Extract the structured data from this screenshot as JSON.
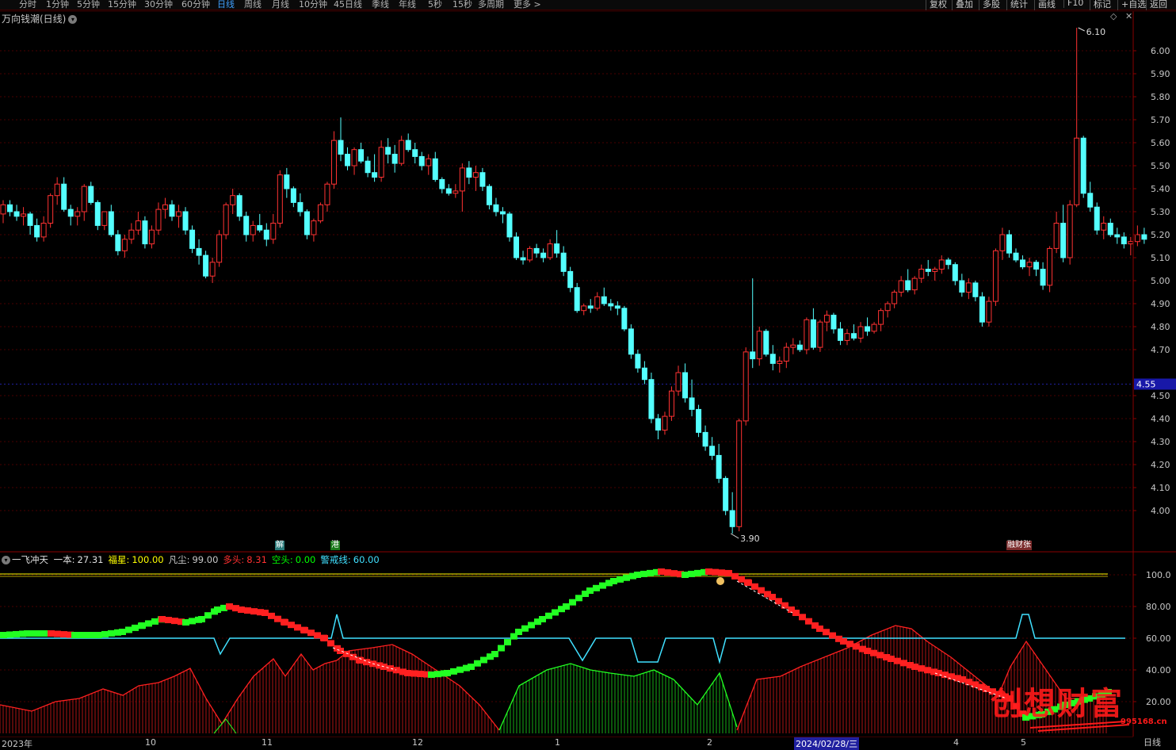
{
  "toolbar": {
    "periods": [
      "分时",
      "1分钟",
      "5分钟",
      "15分钟",
      "30分钟",
      "60分钟",
      "日线",
      "周线",
      "月线",
      "10分钟",
      "45日线",
      "季线",
      "年线",
      "5秒",
      "15秒",
      "多周期",
      "更多 >"
    ],
    "active_period": "日线",
    "tools": [
      "复权",
      "叠加",
      "多股",
      "统计",
      "画线",
      "F10",
      "标记",
      "+自选",
      "返回"
    ]
  },
  "main_chart": {
    "title": "万向钱潮(日线)",
    "price_axis": [
      "6.00",
      "5.90",
      "5.80",
      "5.70",
      "5.60",
      "5.50",
      "5.40",
      "5.30",
      "5.20",
      "5.10",
      "5.00",
      "4.90",
      "4.80",
      "4.70",
      "4.55",
      "4.50",
      "4.40",
      "4.30",
      "4.20",
      "4.10",
      "4.00"
    ],
    "current_price": "4.55",
    "high_label": "6.10",
    "low_label": "3.90",
    "flags": [
      "解",
      "港",
      "融财张"
    ]
  },
  "indicator": {
    "name": "一飞冲天",
    "items": [
      {
        "label": "一本:",
        "value": "27.31",
        "color": "#e0e0e0"
      },
      {
        "label": "福星:",
        "value": "100.00",
        "color": "#ffff00"
      },
      {
        "label": "凡尘:",
        "value": "99.00",
        "color": "#c8c8c8"
      },
      {
        "label": "多头:",
        "value": "8.31",
        "color": "#ff3030"
      },
      {
        "label": "空头:",
        "value": "0.00",
        "color": "#00ff00"
      },
      {
        "label": "警戒线:",
        "value": "60.00",
        "color": "#40e0ff"
      }
    ],
    "axis": [
      "100.0",
      "80.00",
      "60.00",
      "40.00",
      "20.00"
    ]
  },
  "date_axis": {
    "labels": [
      "2023年",
      "10",
      "11",
      "12",
      "1",
      "2",
      "4",
      "5"
    ],
    "current": "2024/02/28/三",
    "period_label": "日线"
  },
  "watermark": {
    "text": "创想财富",
    "sub": "995168.cn"
  },
  "colors": {
    "up": "#ff3232",
    "down": "#54ffff",
    "bull": "#ff2020",
    "bear": "#22ff22",
    "warn": "#40e0ff",
    "level": "#ffff00"
  },
  "chart_data": {
    "type": "candlestick",
    "ohlc": [
      [
        5.29,
        5.35,
        5.25,
        5.33
      ],
      [
        5.33,
        5.35,
        5.28,
        5.3
      ],
      [
        5.3,
        5.33,
        5.26,
        5.28
      ],
      [
        5.28,
        5.32,
        5.24,
        5.29
      ],
      [
        5.29,
        5.3,
        5.2,
        5.24
      ],
      [
        5.24,
        5.27,
        5.17,
        5.19
      ],
      [
        5.19,
        5.28,
        5.17,
        5.25
      ],
      [
        5.25,
        5.38,
        5.23,
        5.37
      ],
      [
        5.37,
        5.45,
        5.33,
        5.42
      ],
      [
        5.42,
        5.45,
        5.3,
        5.31
      ],
      [
        5.31,
        5.33,
        5.24,
        5.28
      ],
      [
        5.28,
        5.32,
        5.24,
        5.3
      ],
      [
        5.3,
        5.42,
        5.26,
        5.41
      ],
      [
        5.41,
        5.43,
        5.33,
        5.34
      ],
      [
        5.34,
        5.35,
        5.22,
        5.24
      ],
      [
        5.24,
        5.3,
        5.22,
        5.3
      ],
      [
        5.3,
        5.33,
        5.19,
        5.2
      ],
      [
        5.2,
        5.22,
        5.11,
        5.13
      ],
      [
        5.13,
        5.2,
        5.1,
        5.18
      ],
      [
        5.18,
        5.25,
        5.16,
        5.22
      ],
      [
        5.22,
        5.3,
        5.2,
        5.26
      ],
      [
        5.26,
        5.28,
        5.14,
        5.16
      ],
      [
        5.16,
        5.24,
        5.14,
        5.22
      ],
      [
        5.22,
        5.34,
        5.2,
        5.31
      ],
      [
        5.31,
        5.36,
        5.27,
        5.33
      ],
      [
        5.33,
        5.35,
        5.26,
        5.28
      ],
      [
        5.28,
        5.33,
        5.23,
        5.3
      ],
      [
        5.3,
        5.32,
        5.2,
        5.22
      ],
      [
        5.22,
        5.24,
        5.12,
        5.14
      ],
      [
        5.14,
        5.18,
        5.07,
        5.11
      ],
      [
        5.11,
        5.13,
        5.01,
        5.02
      ],
      [
        5.02,
        5.1,
        4.99,
        5.08
      ],
      [
        5.08,
        5.22,
        5.06,
        5.2
      ],
      [
        5.2,
        5.34,
        5.18,
        5.33
      ],
      [
        5.33,
        5.4,
        5.29,
        5.37
      ],
      [
        5.37,
        5.38,
        5.26,
        5.28
      ],
      [
        5.28,
        5.3,
        5.17,
        5.2
      ],
      [
        5.2,
        5.26,
        5.17,
        5.24
      ],
      [
        5.24,
        5.29,
        5.21,
        5.22
      ],
      [
        5.22,
        5.25,
        5.15,
        5.18
      ],
      [
        5.18,
        5.29,
        5.16,
        5.25
      ],
      [
        5.25,
        5.48,
        5.23,
        5.46
      ],
      [
        5.46,
        5.49,
        5.36,
        5.4
      ],
      [
        5.4,
        5.41,
        5.32,
        5.34
      ],
      [
        5.34,
        5.38,
        5.28,
        5.3
      ],
      [
        5.3,
        5.31,
        5.18,
        5.2
      ],
      [
        5.2,
        5.27,
        5.17,
        5.26
      ],
      [
        5.26,
        5.34,
        5.25,
        5.33
      ],
      [
        5.33,
        5.43,
        5.3,
        5.42
      ],
      [
        5.42,
        5.65,
        5.4,
        5.61
      ],
      [
        5.61,
        5.71,
        5.52,
        5.55
      ],
      [
        5.55,
        5.58,
        5.48,
        5.5
      ],
      [
        5.5,
        5.58,
        5.46,
        5.57
      ],
      [
        5.57,
        5.6,
        5.51,
        5.52
      ],
      [
        5.52,
        5.54,
        5.45,
        5.47
      ],
      [
        5.47,
        5.55,
        5.43,
        5.45
      ],
      [
        5.45,
        5.61,
        5.43,
        5.58
      ],
      [
        5.58,
        5.62,
        5.51,
        5.55
      ],
      [
        5.55,
        5.59,
        5.47,
        5.51
      ],
      [
        5.51,
        5.63,
        5.5,
        5.61
      ],
      [
        5.61,
        5.64,
        5.56,
        5.57
      ],
      [
        5.57,
        5.6,
        5.51,
        5.54
      ],
      [
        5.54,
        5.56,
        5.48,
        5.5
      ],
      [
        5.5,
        5.55,
        5.46,
        5.53
      ],
      [
        5.53,
        5.56,
        5.43,
        5.44
      ],
      [
        5.44,
        5.45,
        5.38,
        5.4
      ],
      [
        5.4,
        5.42,
        5.37,
        5.38
      ],
      [
        5.38,
        5.42,
        5.36,
        5.39
      ],
      [
        5.39,
        5.51,
        5.3,
        5.49
      ],
      [
        5.49,
        5.52,
        5.42,
        5.45
      ],
      [
        5.45,
        5.5,
        5.39,
        5.47
      ],
      [
        5.47,
        5.49,
        5.39,
        5.41
      ],
      [
        5.41,
        5.42,
        5.31,
        5.33
      ],
      [
        5.33,
        5.36,
        5.28,
        5.3
      ],
      [
        5.3,
        5.32,
        5.25,
        5.29
      ],
      [
        5.29,
        5.3,
        5.17,
        5.19
      ],
      [
        5.19,
        5.21,
        5.09,
        5.1
      ],
      [
        5.1,
        5.13,
        5.07,
        5.09
      ],
      [
        5.09,
        5.15,
        5.08,
        5.14
      ],
      [
        5.14,
        5.16,
        5.1,
        5.12
      ],
      [
        5.12,
        5.14,
        5.08,
        5.1
      ],
      [
        5.1,
        5.18,
        5.09,
        5.16
      ],
      [
        5.16,
        5.22,
        5.1,
        5.12
      ],
      [
        5.12,
        5.15,
        5.02,
        5.04
      ],
      [
        5.04,
        5.06,
        4.95,
        4.97
      ],
      [
        4.97,
        4.99,
        4.86,
        4.87
      ],
      [
        4.87,
        4.9,
        4.85,
        4.89
      ],
      [
        4.89,
        4.92,
        4.86,
        4.88
      ],
      [
        4.88,
        4.95,
        4.87,
        4.93
      ],
      [
        4.93,
        4.97,
        4.89,
        4.9
      ],
      [
        4.9,
        4.92,
        4.87,
        4.89
      ],
      [
        4.89,
        4.91,
        4.85,
        4.88
      ],
      [
        4.88,
        4.89,
        4.78,
        4.79
      ],
      [
        4.79,
        4.81,
        4.66,
        4.68
      ],
      [
        4.68,
        4.7,
        4.6,
        4.62
      ],
      [
        4.62,
        4.65,
        4.55,
        4.57
      ],
      [
        4.57,
        4.6,
        4.38,
        4.4
      ],
      [
        4.4,
        4.42,
        4.31,
        4.35
      ],
      [
        4.35,
        4.43,
        4.33,
        4.41
      ],
      [
        4.41,
        4.54,
        4.39,
        4.52
      ],
      [
        4.52,
        4.63,
        4.5,
        4.6
      ],
      [
        4.6,
        4.64,
        4.47,
        4.49
      ],
      [
        4.49,
        4.57,
        4.41,
        4.44
      ],
      [
        4.44,
        4.46,
        4.32,
        4.34
      ],
      [
        4.34,
        4.37,
        4.26,
        4.28
      ],
      [
        4.28,
        4.32,
        4.22,
        4.24
      ],
      [
        4.24,
        4.29,
        4.12,
        4.14
      ],
      [
        4.14,
        4.15,
        3.98,
        4.0
      ],
      [
        4.0,
        4.08,
        3.9,
        3.93
      ],
      [
        3.93,
        4.4,
        3.91,
        4.39
      ],
      [
        4.39,
        4.71,
        4.37,
        4.69
      ],
      [
        4.69,
        5.01,
        4.62,
        4.66
      ],
      [
        4.66,
        4.8,
        4.63,
        4.78
      ],
      [
        4.78,
        4.79,
        4.67,
        4.68
      ],
      [
        4.68,
        4.72,
        4.61,
        4.64
      ],
      [
        4.64,
        4.67,
        4.6,
        4.65
      ],
      [
        4.65,
        4.73,
        4.62,
        4.71
      ],
      [
        4.71,
        4.75,
        4.68,
        4.72
      ],
      [
        4.72,
        4.74,
        4.69,
        4.7
      ],
      [
        4.7,
        4.84,
        4.68,
        4.83
      ],
      [
        4.83,
        4.88,
        4.7,
        4.71
      ],
      [
        4.71,
        4.83,
        4.69,
        4.82
      ],
      [
        4.82,
        4.87,
        4.78,
        4.85
      ],
      [
        4.85,
        4.86,
        4.77,
        4.79
      ],
      [
        4.79,
        4.82,
        4.72,
        4.74
      ],
      [
        4.74,
        4.79,
        4.72,
        4.77
      ],
      [
        4.77,
        4.81,
        4.74,
        4.75
      ],
      [
        4.75,
        4.82,
        4.73,
        4.8
      ],
      [
        4.8,
        4.84,
        4.76,
        4.78
      ],
      [
        4.78,
        4.82,
        4.77,
        4.81
      ],
      [
        4.81,
        4.88,
        4.78,
        4.87
      ],
      [
        4.87,
        4.91,
        4.84,
        4.9
      ],
      [
        4.9,
        4.96,
        4.88,
        4.95
      ],
      [
        4.95,
        5.02,
        4.93,
        5.0
      ],
      [
        5.0,
        5.05,
        4.95,
        4.96
      ],
      [
        4.96,
        5.02,
        4.94,
        5.01
      ],
      [
        5.01,
        5.07,
        4.99,
        5.05
      ],
      [
        5.05,
        5.09,
        5.02,
        5.04
      ],
      [
        5.04,
        5.06,
        5.0,
        5.05
      ],
      [
        5.05,
        5.11,
        5.03,
        5.09
      ],
      [
        5.09,
        5.1,
        5.05,
        5.07
      ],
      [
        5.07,
        5.08,
        4.98,
        5.0
      ],
      [
        5.0,
        5.03,
        4.93,
        4.95
      ],
      [
        4.95,
        5.01,
        4.92,
        4.99
      ],
      [
        4.99,
        5.0,
        4.91,
        4.93
      ],
      [
        4.93,
        4.95,
        4.8,
        4.82
      ],
      [
        4.82,
        4.93,
        4.8,
        4.91
      ],
      [
        4.91,
        5.14,
        4.89,
        5.13
      ],
      [
        5.13,
        5.23,
        5.09,
        5.2
      ],
      [
        5.2,
        5.22,
        5.1,
        5.12
      ],
      [
        5.12,
        5.14,
        5.08,
        5.09
      ],
      [
        5.09,
        5.11,
        5.05,
        5.06
      ],
      [
        5.06,
        5.1,
        5.02,
        5.08
      ],
      [
        5.08,
        5.09,
        5.02,
        5.05
      ],
      [
        5.05,
        5.08,
        4.96,
        4.98
      ],
      [
        4.98,
        5.15,
        4.95,
        5.14
      ],
      [
        5.14,
        5.3,
        5.12,
        5.25
      ],
      [
        5.25,
        5.33,
        5.08,
        5.1
      ],
      [
        5.1,
        5.35,
        5.07,
        5.33
      ],
      [
        5.33,
        6.1,
        5.32,
        5.62
      ],
      [
        5.62,
        5.63,
        5.36,
        5.38
      ],
      [
        5.38,
        5.43,
        5.3,
        5.32
      ],
      [
        5.32,
        5.34,
        5.2,
        5.22
      ],
      [
        5.22,
        5.28,
        5.18,
        5.25
      ],
      [
        5.25,
        5.27,
        5.19,
        5.2
      ],
      [
        5.2,
        5.23,
        5.16,
        5.19
      ],
      [
        5.19,
        5.21,
        5.14,
        5.16
      ],
      [
        5.16,
        5.19,
        5.11,
        5.17
      ],
      [
        5.17,
        5.24,
        5.15,
        5.2
      ],
      [
        5.2,
        5.23,
        5.16,
        5.18
      ]
    ]
  }
}
